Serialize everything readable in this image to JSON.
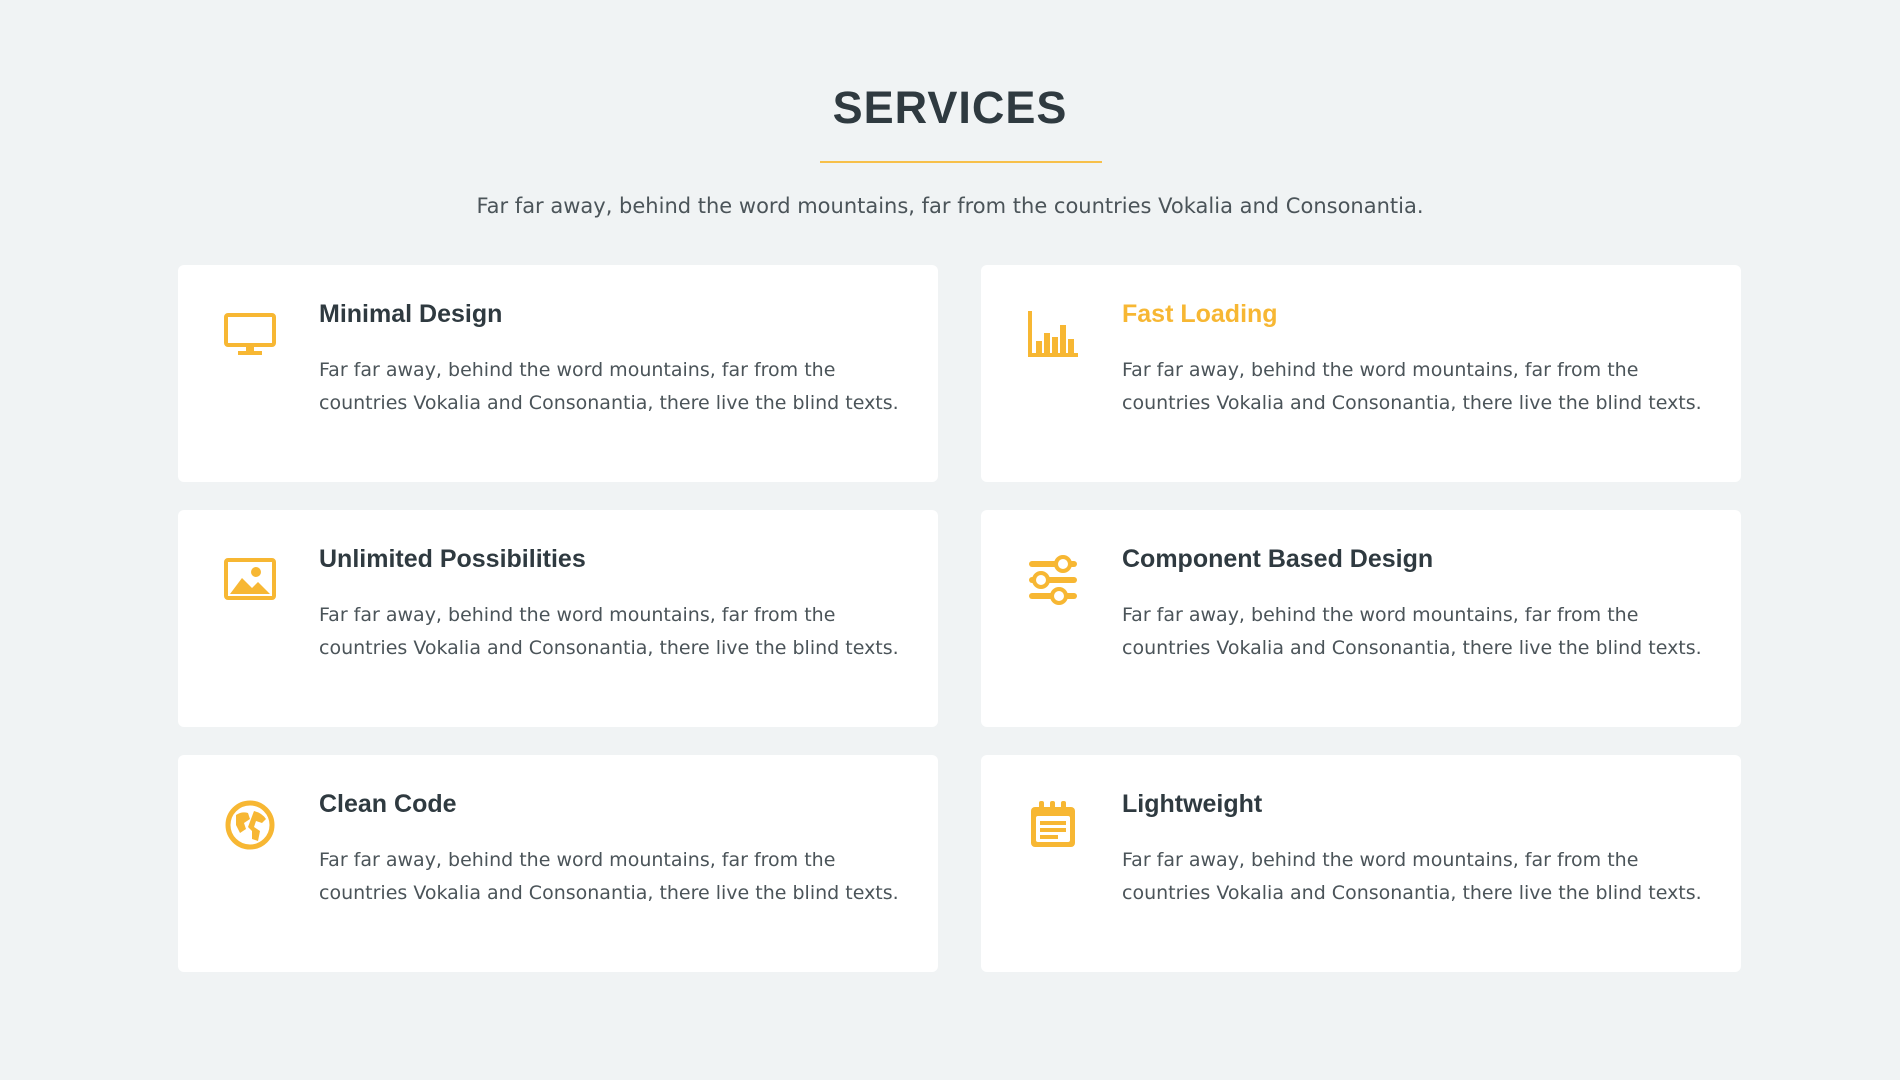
{
  "section": {
    "title": "SERVICES",
    "subtitle": "Far far away, behind the word mountains, far from the countries Vokalia and Consonantia."
  },
  "colors": {
    "accent": "#f7b733",
    "background": "#f0f3f4",
    "card": "#ffffff",
    "heading": "#2f3a40",
    "text": "#4b5459"
  },
  "services": [
    {
      "icon": "monitor-icon",
      "title": "Minimal Design",
      "text": "Far far away, behind the word mountains, far from the countries Vokalia and Consonantia, there live the blind texts."
    },
    {
      "icon": "bar-chart-icon",
      "title": "Fast Loading",
      "text": "Far far away, behind the word mountains, far from the countries Vokalia and Consonantia, there live the blind texts."
    },
    {
      "icon": "image-icon",
      "title": "Unlimited Possibilities",
      "text": "Far far away, behind the word mountains, far from the countries Vokalia and Consonantia, there live the blind texts."
    },
    {
      "icon": "sliders-icon",
      "title": "Component Based Design",
      "text": "Far far away, behind the word mountains, far from the countries Vokalia and Consonantia, there live the blind texts."
    },
    {
      "icon": "globe-icon",
      "title": "Clean Code",
      "text": "Far far away, behind the word mountains, far from the countries Vokalia and Consonantia, there live the blind texts."
    },
    {
      "icon": "notepad-icon",
      "title": "Lightweight",
      "text": "Far far away, behind the word mountains, far from the countries Vokalia and Consonantia, there live the blind texts."
    }
  ]
}
